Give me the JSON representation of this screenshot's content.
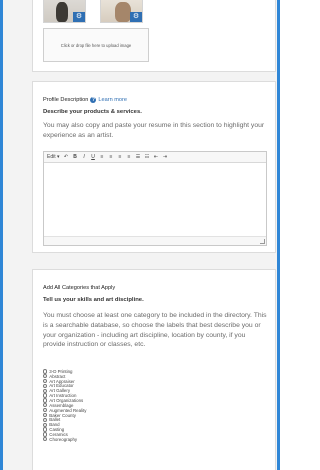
{
  "upload": {
    "dropzone_text": "Click or drop file here to upload image",
    "gear_glyph": "⚙"
  },
  "profile": {
    "label": "Profile Description",
    "learn_more": "Learn more",
    "heading": "Describe your products & services.",
    "paragraph": "You may also copy and paste your resume in this section to highlight your experience as an artist.",
    "toolbar": [
      "Edit ▾",
      "↶",
      "B",
      "I",
      "U",
      "≡",
      "≡",
      "≡",
      "≡",
      "☰",
      "☷",
      "⇤",
      "⇥"
    ]
  },
  "categories": {
    "label": "Add All Categories that Apply",
    "heading": "Tell us your skills and art discipline.",
    "paragraph": "You must choose at least one category to be included in the directory. This is a searchable database, so choose the labels that best describe you or your organization - including art discipline, location by county, if you provide instruction or classes, etc.",
    "items": [
      "3-D Printing",
      "Abstract",
      "Art Appraiser",
      "Art Educator",
      "Art Gallery",
      "Art Instruction",
      "Art Organizations",
      "Assemblage",
      "Augmented Reality",
      "Baker County",
      "Ballet",
      "Band",
      "Casting",
      "Ceramics",
      "Choreography"
    ]
  },
  "colors": {
    "accent": "#2f86d6",
    "link": "#2f6fb3"
  }
}
